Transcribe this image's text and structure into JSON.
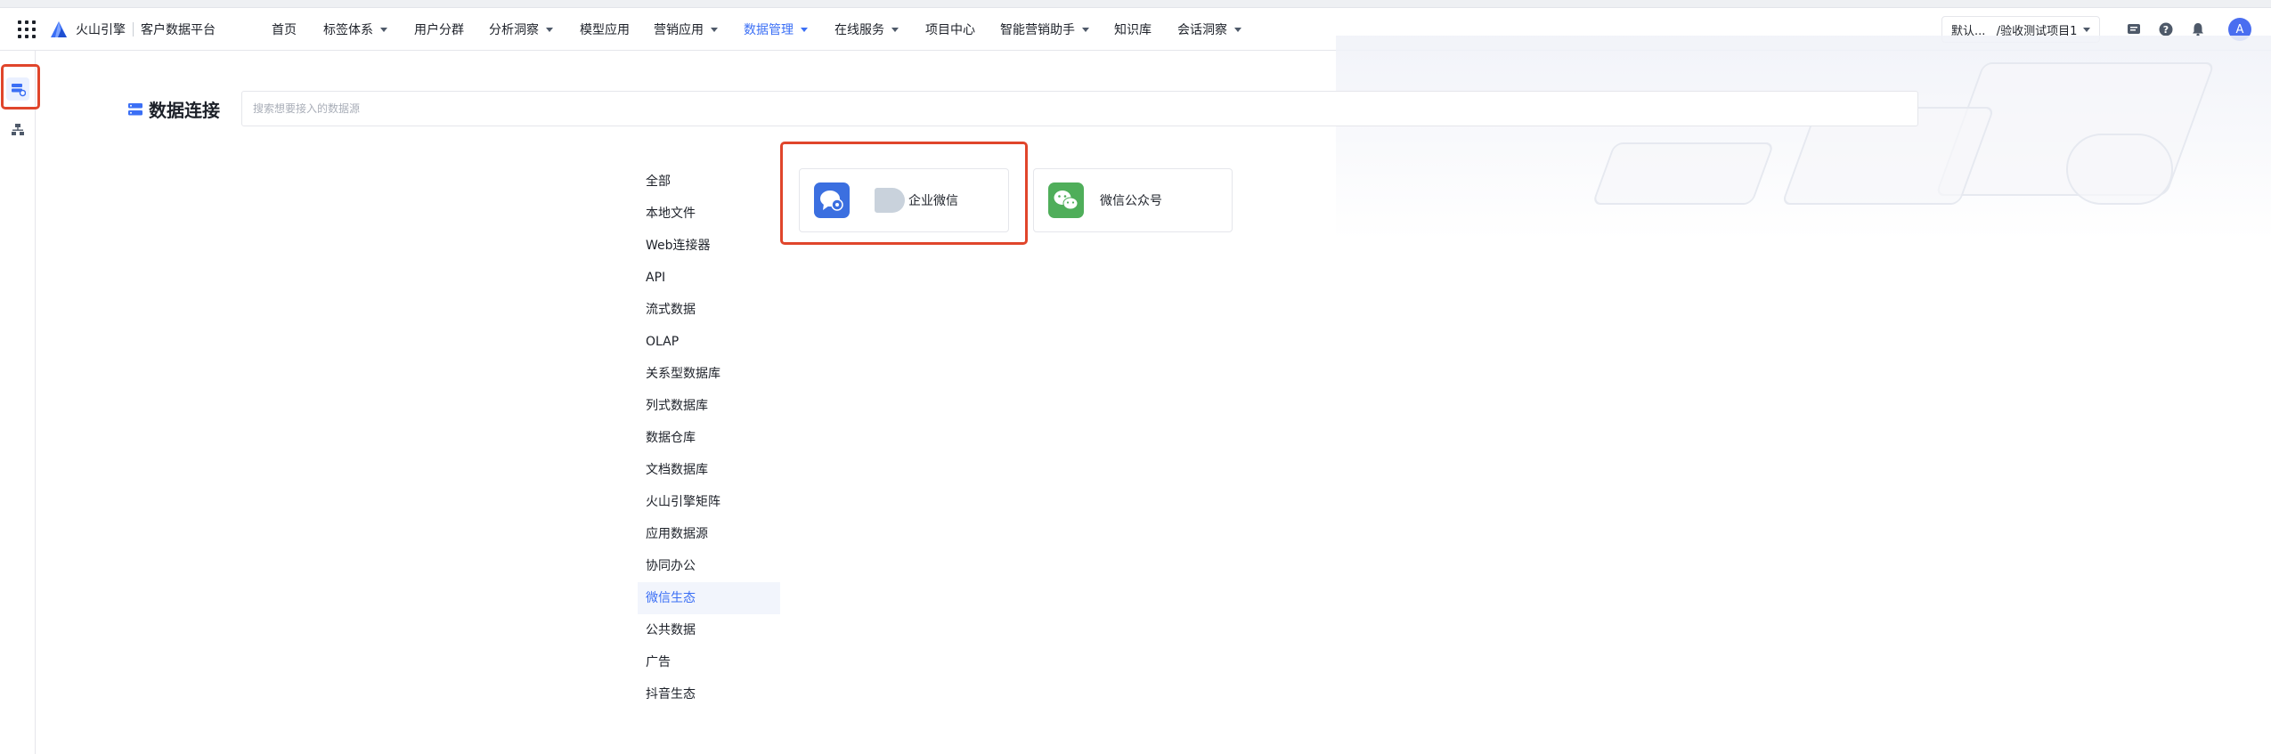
{
  "header": {
    "brand_name": "火山引擎",
    "brand_sub": "客户数据平台",
    "nav": [
      {
        "label": "首页",
        "has_menu": false,
        "active": false
      },
      {
        "label": "标签体系",
        "has_menu": true,
        "active": false
      },
      {
        "label": "用户分群",
        "has_menu": false,
        "active": false
      },
      {
        "label": "分析洞察",
        "has_menu": true,
        "active": false
      },
      {
        "label": "模型应用",
        "has_menu": false,
        "active": false
      },
      {
        "label": "营销应用",
        "has_menu": true,
        "active": false
      },
      {
        "label": "数据管理",
        "has_menu": true,
        "active": true
      },
      {
        "label": "在线服务",
        "has_menu": true,
        "active": false
      },
      {
        "label": "项目中心",
        "has_menu": false,
        "active": false
      },
      {
        "label": "智能营销助手",
        "has_menu": true,
        "active": false
      },
      {
        "label": "知识库",
        "has_menu": false,
        "active": false
      },
      {
        "label": "会话洞察",
        "has_menu": true,
        "active": false
      }
    ],
    "project_selector": "默认...   /验收测试项目1",
    "avatar_initial": "A",
    "icons": [
      "message-icon",
      "help-icon",
      "bell-icon"
    ]
  },
  "rail": {
    "items": [
      {
        "icon": "data-source-icon",
        "active": true
      },
      {
        "icon": "org-tree-icon",
        "active": false
      }
    ]
  },
  "main": {
    "title": "数据连接",
    "search_placeholder": "搜索想要接入的数据源",
    "categories": [
      {
        "label": "全部",
        "active": false
      },
      {
        "label": "本地文件",
        "active": false
      },
      {
        "label": "Web连接器",
        "active": false
      },
      {
        "label": "API",
        "active": false
      },
      {
        "label": "流式数据",
        "active": false
      },
      {
        "label": "OLAP",
        "active": false
      },
      {
        "label": "关系型数据库",
        "active": false
      },
      {
        "label": "列式数据库",
        "active": false
      },
      {
        "label": "数据仓库",
        "active": false
      },
      {
        "label": "文档数据库",
        "active": false
      },
      {
        "label": "火山引擎矩阵",
        "active": false
      },
      {
        "label": "应用数据源",
        "active": false
      },
      {
        "label": "协同办公",
        "active": false
      },
      {
        "label": "微信生态",
        "active": true
      },
      {
        "label": "公共数据",
        "active": false
      },
      {
        "label": "广告",
        "active": false
      },
      {
        "label": "抖音生态",
        "active": false
      }
    ],
    "cards": [
      {
        "label": "企业微信",
        "icon": "wecom-icon",
        "color": "#3b6fe0"
      },
      {
        "label": "微信公众号",
        "icon": "wechat-icon",
        "color": "#4fae5a"
      }
    ]
  },
  "colors": {
    "accent": "#3b6ff5",
    "highlight_box": "#e0452b"
  }
}
